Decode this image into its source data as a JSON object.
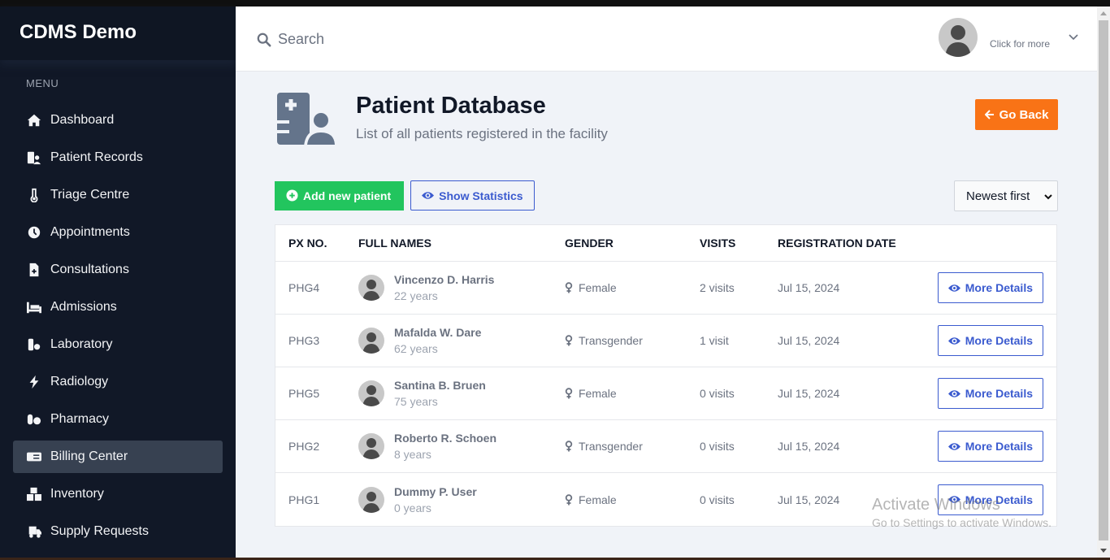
{
  "app": {
    "brand": "CDMS Demo"
  },
  "sidebar": {
    "menu_label": "MENU",
    "items": [
      {
        "label": "Dashboard",
        "icon": "home-icon",
        "active": false
      },
      {
        "label": "Patient Records",
        "icon": "patient-records-icon",
        "active": false
      },
      {
        "label": "Triage Centre",
        "icon": "thermometer-icon",
        "active": false
      },
      {
        "label": "Appointments",
        "icon": "clock-icon",
        "active": false
      },
      {
        "label": "Consultations",
        "icon": "file-medical-icon",
        "active": false
      },
      {
        "label": "Admissions",
        "icon": "hospital-bed-icon",
        "active": false
      },
      {
        "label": "Laboratory",
        "icon": "vial-gear-icon",
        "active": false
      },
      {
        "label": "Radiology",
        "icon": "bolt-icon",
        "active": false
      },
      {
        "label": "Pharmacy",
        "icon": "pills-icon",
        "active": false
      },
      {
        "label": "Billing Center",
        "icon": "money-check-icon",
        "active": true
      },
      {
        "label": "Inventory",
        "icon": "boxes-icon",
        "active": false
      },
      {
        "label": "Supply Requests",
        "icon": "truck-icon",
        "active": false
      }
    ]
  },
  "topbar": {
    "search_placeholder": "Search",
    "search_value": "",
    "user_label": "Click for more"
  },
  "page": {
    "title": "Patient Database",
    "subtitle": "List of all patients registered in the facility",
    "go_back_label": "Go Back",
    "add_patient_label": "Add new patient",
    "show_stats_label": "Show Statistics",
    "sort_selected": "Newest first"
  },
  "table": {
    "headers": [
      "PX NO.",
      "FULL NAMES",
      "GENDER",
      "VISITS",
      "REGISTRATION DATE"
    ],
    "action_label": "More Details",
    "rows": [
      {
        "px_no": "PHG4",
        "name": "Vincenzo D. Harris",
        "age": "22 years",
        "gender": "Female",
        "visits": "2 visits",
        "date": "Jul 15, 2024"
      },
      {
        "px_no": "PHG3",
        "name": "Mafalda W. Dare",
        "age": "62 years",
        "gender": "Transgender",
        "visits": "1 visit",
        "date": "Jul 15, 2024"
      },
      {
        "px_no": "PHG5",
        "name": "Santina B. Bruen",
        "age": "75 years",
        "gender": "Female",
        "visits": "0 visits",
        "date": "Jul 15, 2024"
      },
      {
        "px_no": "PHG2",
        "name": "Roberto R. Schoen",
        "age": "8 years",
        "gender": "Transgender",
        "visits": "0 visits",
        "date": "Jul 15, 2024"
      },
      {
        "px_no": "PHG1",
        "name": "Dummy P. User",
        "age": "0 years",
        "gender": "Female",
        "visits": "0 visits",
        "date": "Jul 15, 2024"
      }
    ]
  },
  "watermark": {
    "line1": "Activate Windows",
    "line2": "Go to Settings to activate Windows."
  },
  "colors": {
    "sidebar_bg": "#111827",
    "active_item_bg": "#374151",
    "primary": "#3b5bcf",
    "success": "#22c55e",
    "warning": "#f97316"
  }
}
